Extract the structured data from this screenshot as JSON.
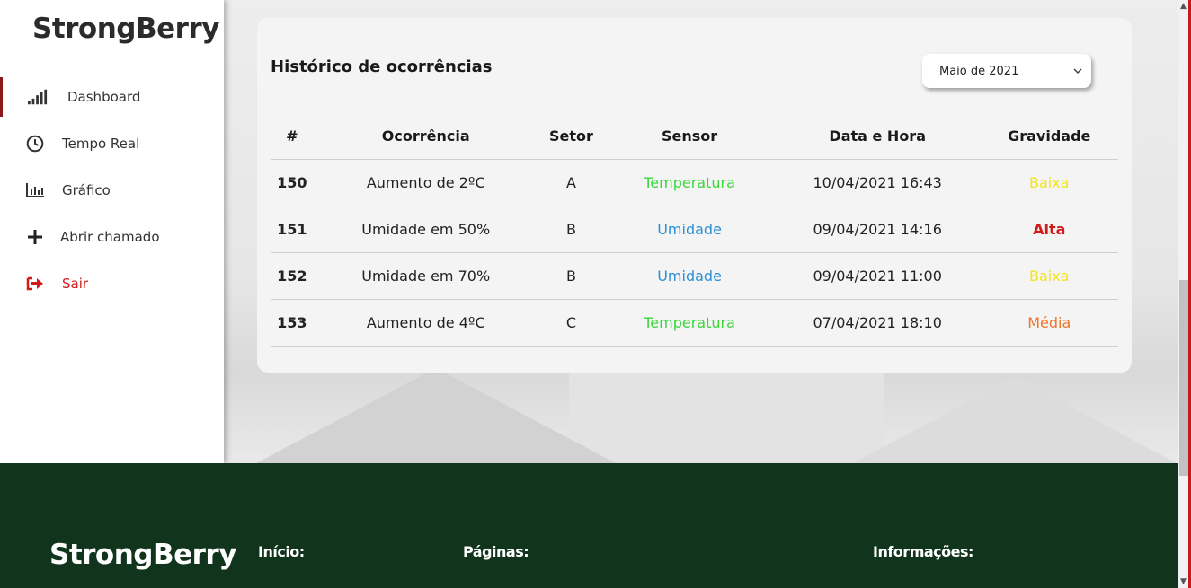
{
  "sidebar": {
    "brand": "StrongBerry",
    "items": [
      {
        "label": "Dashboard",
        "icon": "signal-bars-icon"
      },
      {
        "label": "Tempo Real",
        "icon": "clock-icon"
      },
      {
        "label": "Gráfico",
        "icon": "bar-chart-icon"
      },
      {
        "label": "Abrir chamado",
        "icon": "plus-icon"
      },
      {
        "label": "Sair",
        "icon": "sign-out-icon"
      }
    ]
  },
  "card": {
    "title": "Histórico de ocorrências",
    "month_select": {
      "value": "Maio de 2021"
    }
  },
  "table": {
    "headers": [
      "#",
      "Ocorrência",
      "Setor",
      "Sensor",
      "Data e Hora",
      "Gravidade"
    ],
    "rows": [
      {
        "id": "150",
        "ocorrencia": "Aumento de 2ºC",
        "setor": "A",
        "sensor": "Temperatura",
        "datahora": "10/04/2021 16:43",
        "gravidade": "Baixa"
      },
      {
        "id": "151",
        "ocorrencia": "Umidade em 50%",
        "setor": "B",
        "sensor": "Umidade",
        "datahora": "09/04/2021 14:16",
        "gravidade": "Alta"
      },
      {
        "id": "152",
        "ocorrencia": "Umidade em 70%",
        "setor": "B",
        "sensor": "Umidade",
        "datahora": "09/04/2021 11:00",
        "gravidade": "Baixa"
      },
      {
        "id": "153",
        "ocorrencia": "Aumento de 4ºC",
        "setor": "C",
        "sensor": "Temperatura",
        "datahora": "07/04/2021 18:10",
        "gravidade": "Média"
      }
    ]
  },
  "colors": {
    "temperatura": "#3ad63a",
    "umidade": "#2a8fd6",
    "baixa": "#f2e61a",
    "alta": "#d11a1a",
    "media": "#f0742a",
    "footer_bg": "#11341c",
    "active_accent": "#8b1a1a"
  },
  "footer": {
    "brand": "StrongBerry",
    "inicio": "Início:",
    "paginas": "Páginas:",
    "informacoes": "Informações:"
  }
}
